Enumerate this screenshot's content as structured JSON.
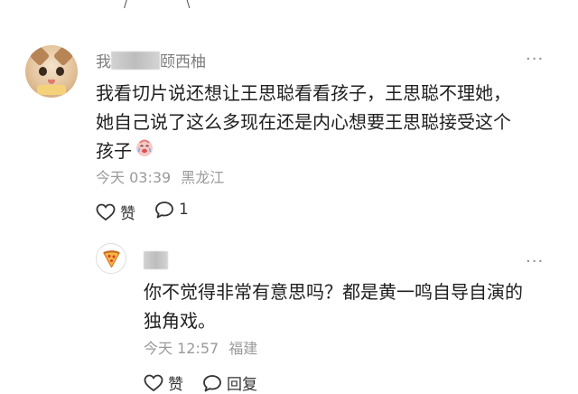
{
  "top_strip": {
    "glyphs": [
      "/",
      "\\"
    ]
  },
  "comment": {
    "author_prefix": "我",
    "author_suffix": "颐西柚",
    "content_lines": [
      "我看切片说还想让王思聪看看孩子，王思聪不理她，",
      "她自己说了这么多现在还是内心想要王思聪接受这个",
      "孩子"
    ],
    "emoji_icon": "crying-emoji-icon",
    "time": "今天 03:39",
    "location": "黑龙江",
    "like_label": "赞",
    "reply_count": "1"
  },
  "reply": {
    "avatar_icon": "pizza-icon",
    "content_lines": [
      "你不觉得非常有意思吗？都是黄一鸣自导自演的",
      "独角戏。"
    ],
    "time": "今天 12:57",
    "location": "福建",
    "like_label": "赞",
    "reply_label": "回复"
  },
  "more_label": "···",
  "colors": {
    "meta_gray": "#9a9a9a",
    "name_gray": "#7d7d7d",
    "text": "#1f1f1f",
    "icon": "#333333"
  }
}
